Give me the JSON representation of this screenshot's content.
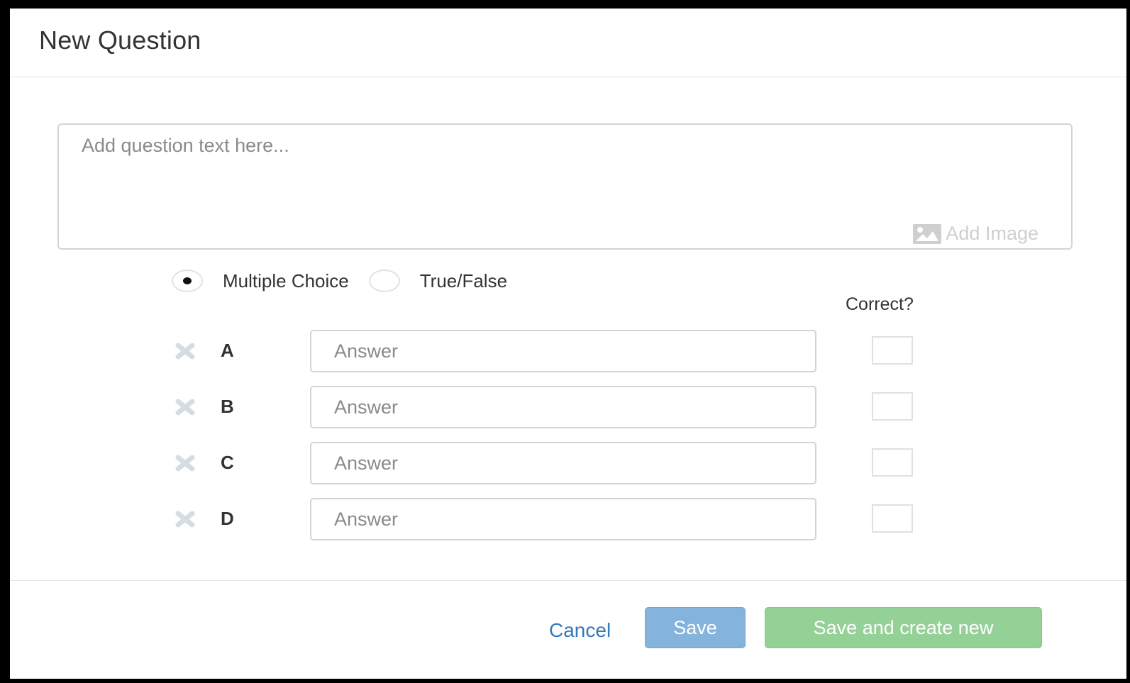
{
  "dialog": {
    "title": "New Question"
  },
  "question": {
    "placeholder": "Add question text here...",
    "add_image_label": "Add Image",
    "add_image_icon": "image-icon"
  },
  "question_types": [
    {
      "label": "Multiple Choice",
      "selected": true
    },
    {
      "label": "True/False",
      "selected": false
    }
  ],
  "correct_header": "Correct?",
  "answers": [
    {
      "letter": "A",
      "placeholder": "Answer",
      "value": "",
      "correct": false,
      "remove_icon": "close-icon"
    },
    {
      "letter": "B",
      "placeholder": "Answer",
      "value": "",
      "correct": false,
      "remove_icon": "close-icon"
    },
    {
      "letter": "C",
      "placeholder": "Answer",
      "value": "",
      "correct": false,
      "remove_icon": "close-icon"
    },
    {
      "letter": "D",
      "placeholder": "Answer",
      "value": "",
      "correct": false,
      "remove_icon": "close-icon"
    }
  ],
  "footer": {
    "cancel_label": "Cancel",
    "save_label": "Save",
    "save_new_label": "Save and create new"
  },
  "colors": {
    "link": "#337ab7",
    "save_button": "#84b3dc",
    "save_new_button": "#94d196",
    "remove_icon": "#d5dce2",
    "add_image": "#cfcfcf"
  }
}
